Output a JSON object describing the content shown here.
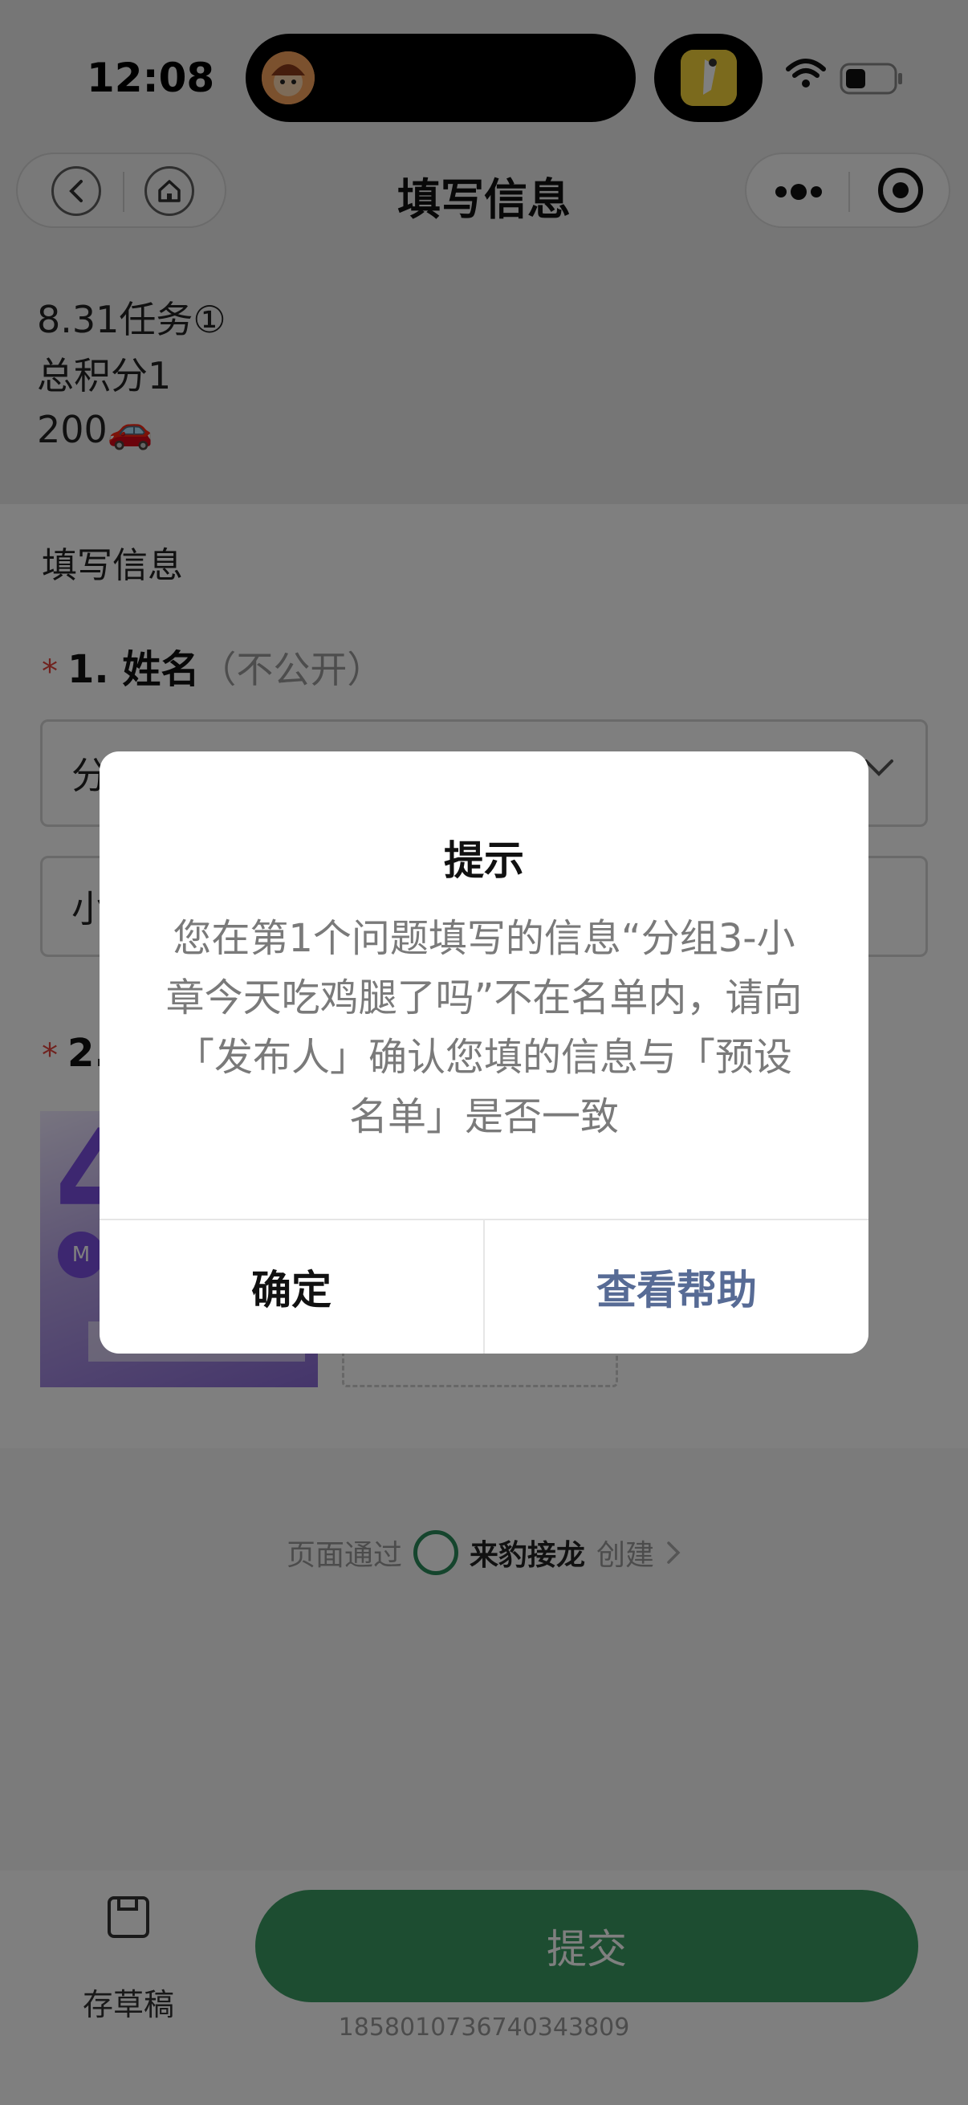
{
  "status_bar": {
    "time": "12:08"
  },
  "nav": {
    "title": "填写信息"
  },
  "header": {
    "line1": "8.31任务①",
    "line2": "总积分1",
    "line3": "200🚗"
  },
  "form": {
    "section_title": "填写信息",
    "q1": {
      "number": "1. 姓名",
      "note": "（不公开）",
      "select_value": "分",
      "input_value": "小"
    },
    "q2": {
      "number": "2."
    }
  },
  "footer": {
    "prefix": "页面通过",
    "brand": "来豹接龙",
    "suffix": "创建"
  },
  "bottom": {
    "draft_label": "存草稿",
    "submit_label": "提交",
    "serial": "1858010736740343809"
  },
  "dialog": {
    "title": "提示",
    "body": "您在第1个问题填写的信息“分组3-小章今天吃鸡腿了吗”不在名单内，请向「发布人」确认您填的信息与「预设名单」是否一致",
    "confirm_label": "确定",
    "help_label": "查看帮助"
  },
  "colors": {
    "accent": "#3a9b62",
    "link": "#576b95",
    "required": "#e0443c"
  }
}
